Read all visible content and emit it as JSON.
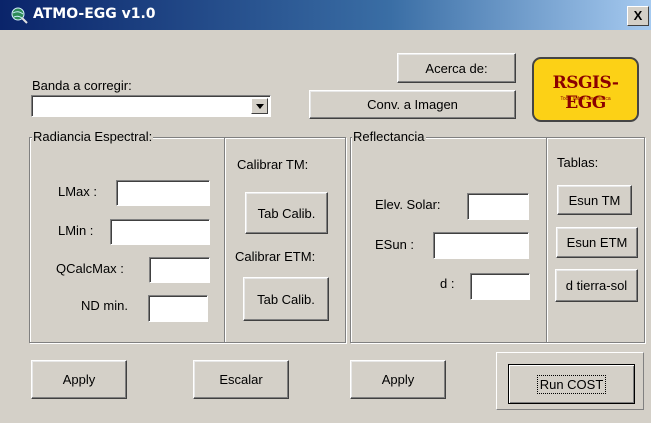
{
  "window": {
    "title": "ATMO-EGG v1.0",
    "close_label": "X",
    "app_icon": "globe-icon"
  },
  "header": {
    "band_label": "Banda a corregir:",
    "band_value": "",
    "about_button": "Acerca de:",
    "convert_button": "Conv. a Imagen",
    "logo_text": "RSGIS-EGG",
    "logo_subtext": "Todo sobre Geomatica"
  },
  "radiance": {
    "title": "Radiancia Espectral:",
    "lmax_label": "LMax :",
    "lmin_label": "LMin :",
    "qcalcmax_label": "QCalcMax :",
    "ndmin_label": "ND min.",
    "lmax_value": "",
    "lmin_value": "",
    "qcalcmax_value": "",
    "ndmin_value": "",
    "calib_tm_label": "Calibrar TM:",
    "calib_etm_label": "Calibrar ETM:",
    "tab_calib_tm_button": "Tab Calib.",
    "tab_calib_etm_button": "Tab Calib."
  },
  "reflectance": {
    "title": "Reflectancia",
    "elev_label": "Elev. Solar:",
    "esun_label": "ESun :",
    "d_label": "d :",
    "elev_value": "",
    "esun_value": "",
    "d_value": "",
    "tables_label": "Tablas:",
    "esun_tm_button": "Esun TM",
    "esun_etm_button": "Esun ETM",
    "d_tierra_sol_button": "d tierra-sol"
  },
  "footer": {
    "apply_radiance_button": "Apply",
    "escalar_button": "Escalar",
    "apply_reflectance_button": "Apply",
    "run_cost_button": "Run COST"
  },
  "colors": {
    "window_bg": "#d4d0c8",
    "title_bar": "#0a246a",
    "logo_bg": "#fcd116",
    "logo_text": "#8b0000"
  }
}
